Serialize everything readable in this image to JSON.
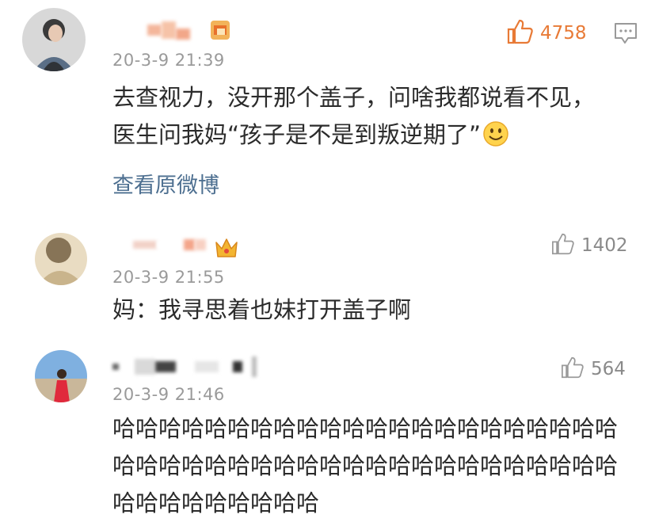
{
  "comments": [
    {
      "date": "20-3-9 21:39",
      "text_line1": "去查视力，没开那个盖子，问啥我都说看不见，",
      "text_line2": "医生问我妈“孩子是不是到叛逆期了”",
      "likes": "4758",
      "view_original": "查看原微博",
      "emoji": "smile-emoji"
    },
    {
      "date": "20-3-9 21:55",
      "text": "妈：我寻思着也妹打开盖子啊",
      "likes": "1402"
    },
    {
      "date": "20-3-9 21:46",
      "text_line1": "哈哈哈哈哈哈哈哈哈哈哈哈哈哈哈哈哈哈哈哈哈哈",
      "text_line2": "哈哈哈哈哈哈哈哈哈哈哈哈哈哈哈哈哈哈哈哈哈哈",
      "text_line3": "哈哈哈哈哈哈哈哈哈",
      "likes": "564"
    }
  ],
  "colors": {
    "like_active": "#e87a36",
    "date": "#9a9a9a",
    "link": "#4d6f90"
  },
  "icons": [
    "thumbs-up-icon",
    "comment-reply-icon",
    "vip-badge-icon",
    "crown-badge-icon",
    "smile-emoji"
  ]
}
